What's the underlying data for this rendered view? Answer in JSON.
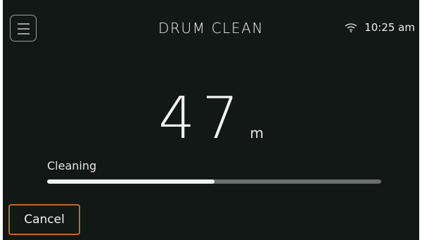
{
  "header": {
    "title": "DRUM CLEAN",
    "time": "10:25 am",
    "menu_icon": "hamburger-menu-icon",
    "wifi_icon": "wifi-icon"
  },
  "timer": {
    "value": "47",
    "unit": "m"
  },
  "progress": {
    "label": "Cleaning",
    "fraction": 0.5
  },
  "actions": {
    "cancel_label": "Cancel"
  },
  "colors": {
    "background": "#121815",
    "accent_border": "#c06a2e",
    "progress_fill": "#f1f3f2",
    "progress_track": "#6b6f6d"
  }
}
